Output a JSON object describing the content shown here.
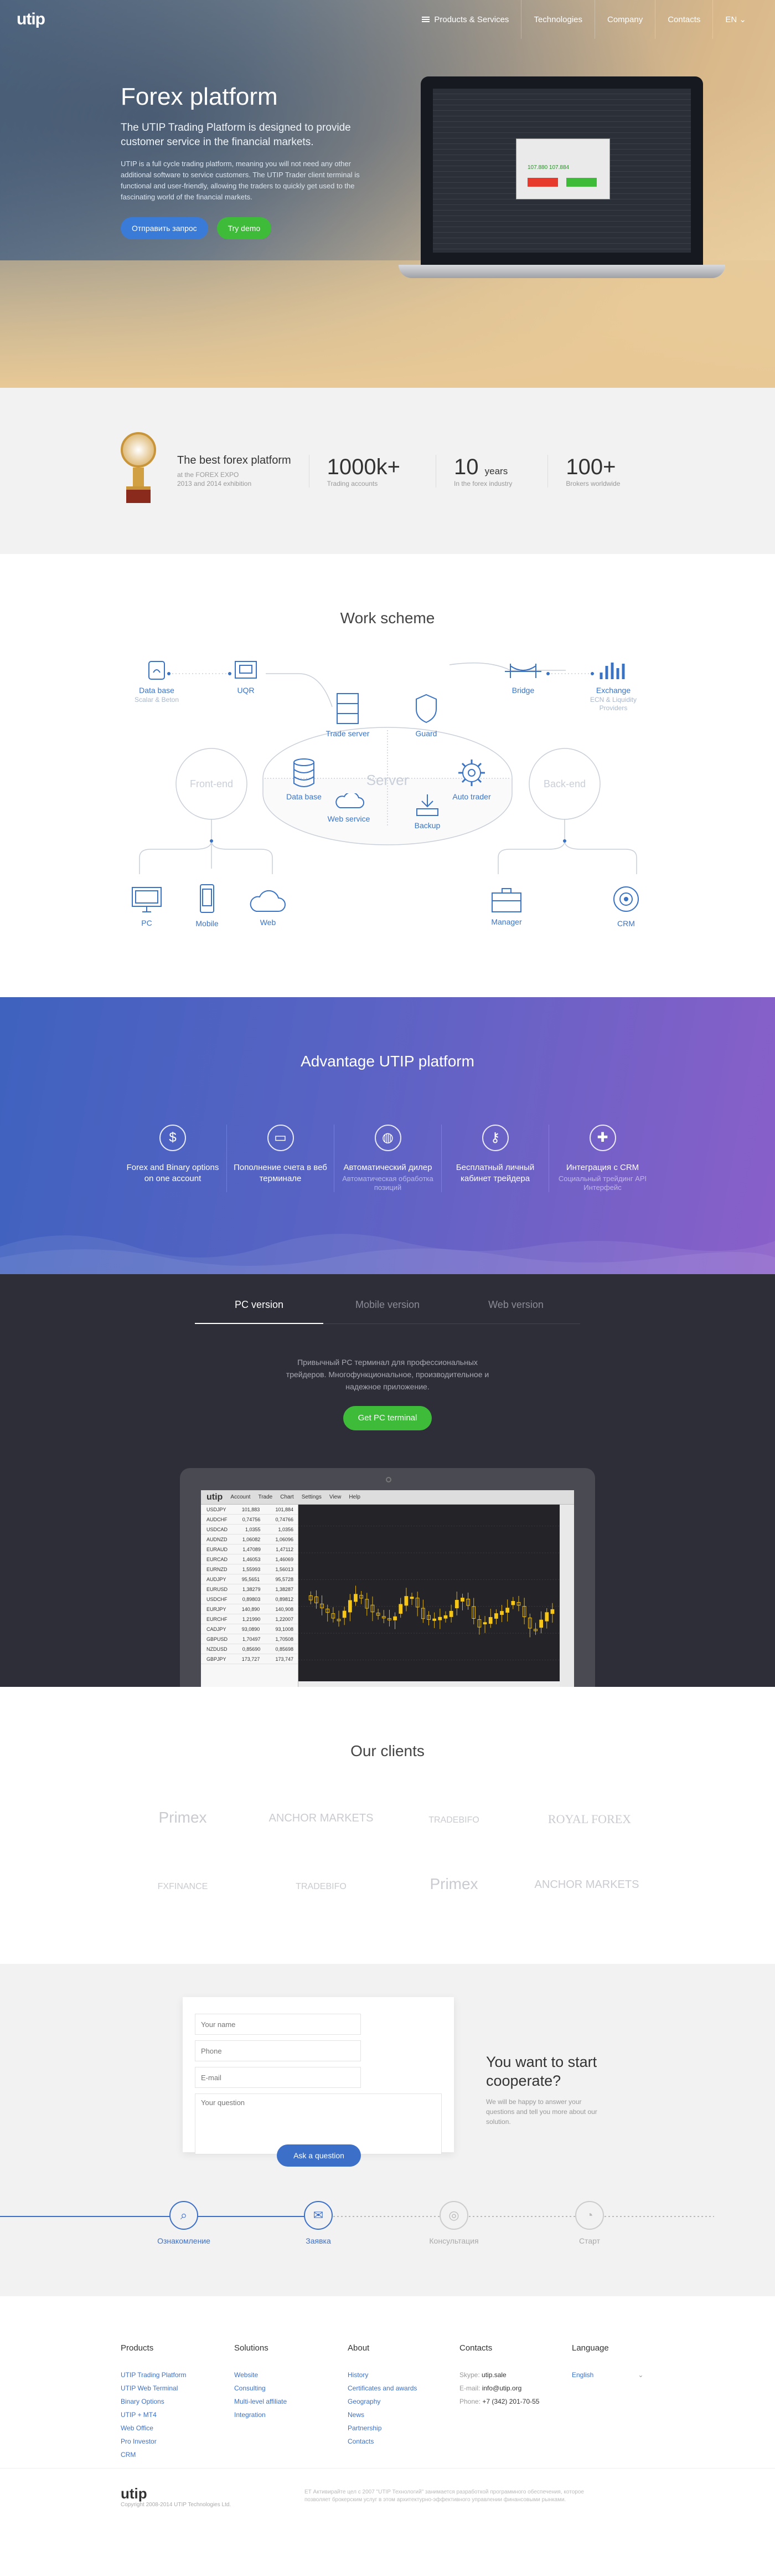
{
  "header": {
    "logo": "utip",
    "nav": [
      "Products & Services",
      "Technologies",
      "Company",
      "Contacts"
    ],
    "lang": "EN"
  },
  "hero": {
    "title": "Forex platform",
    "lead": "The UTIP Trading Platform is designed to provide customer service in the financial markets.",
    "desc": "UTIP is a full cycle trading platform, meaning you will not need any other additional software to service customers. The UTIP Trader client terminal is functional and user-friendly, allowing the traders to quickly get used to the fascinating world of the financial markets.",
    "btn_request": "Отправить запрос",
    "btn_demo": "Try demo",
    "screen_price": "107.880 107.884"
  },
  "stats": {
    "award_title": "The best forex platform",
    "award_sub1": "at the FOREX EXPO",
    "award_sub2": "2013 and 2014 exhibition",
    "items": [
      {
        "big": "1000k+",
        "small": "",
        "label": "Trading accounts"
      },
      {
        "big": "10",
        "small": "years",
        "label": "In the forex industry"
      },
      {
        "big": "100+",
        "small": "",
        "label": "Brokers worldwide"
      }
    ]
  },
  "scheme": {
    "title": "Work scheme",
    "nodes": {
      "database_left": "Data base",
      "database_left_sub": "Scalar & Beton",
      "uqr": "UQR",
      "bridge": "Bridge",
      "exchange": "Exchange",
      "exchange_sub": "ECN & Liquidity Providers",
      "trade_server": "Trade server",
      "guard": "Guard",
      "server": "Server",
      "front_end": "Front-end",
      "back_end": "Back-end",
      "data_base": "Data base",
      "auto_trader": "Auto trader",
      "web_service": "Web service",
      "backup": "Backup",
      "pc": "PC",
      "mobile": "Mobile",
      "web": "Web",
      "manager": "Manager",
      "crm": "CRM"
    }
  },
  "advantage": {
    "title": "Advantage UTIP platform",
    "items": [
      {
        "label": "Forex and Binary options on one account",
        "sub": "",
        "icon": "dollar-icon"
      },
      {
        "label": "Пополнение счета в веб терминале",
        "sub": "",
        "icon": "card-icon"
      },
      {
        "label": "Автоматический дилер",
        "sub": "Автоматическая обработка позиций",
        "icon": "globe-icon"
      },
      {
        "label": "Бесплатный личный кабинет трейдера",
        "sub": "",
        "icon": "key-icon"
      },
      {
        "label": "Интеграция с CRM",
        "sub": "Социальный трейдинг API Интерфейс",
        "icon": "puzzle-icon"
      }
    ]
  },
  "versions": {
    "tabs": [
      "PC version",
      "Mobile version",
      "Web version"
    ],
    "desc": "Привычный PC терминал для профессиональных трейдеров. Многофункциональное, производительное и надежное приложение.",
    "button": "Get PC terminal",
    "terminal": {
      "logo": "utip",
      "menu": [
        "Account",
        "Trade",
        "Chart",
        "Settings",
        "View",
        "Help"
      ],
      "symbols": [
        [
          "USDJPY",
          "101,883",
          "101,884"
        ],
        [
          "AUDCHF",
          "0,74756",
          "0,74766"
        ],
        [
          "USDCAD",
          "1,0355",
          "1,0356"
        ],
        [
          "AUDNZD",
          "1,06082",
          "1,06096"
        ],
        [
          "EURAUD",
          "1,47089",
          "1,47112"
        ],
        [
          "EURCAD",
          "1,46053",
          "1,46069"
        ],
        [
          "EURNZD",
          "1,55993",
          "1,56013"
        ],
        [
          "AUDJPY",
          "95,5651",
          "95,5728"
        ],
        [
          "EURUSD",
          "1,38279",
          "1,38287"
        ],
        [
          "USDCHF",
          "0,89803",
          "0,89812"
        ],
        [
          "EURJPY",
          "140,890",
          "140,908"
        ],
        [
          "EURCHF",
          "1,21990",
          "1,22007"
        ],
        [
          "CADJPY",
          "93,0890",
          "93,1008"
        ],
        [
          "GBPUSD",
          "1,70497",
          "1,70508"
        ],
        [
          "NZDUSD",
          "0,85690",
          "0,85698"
        ],
        [
          "GBPJPY",
          "173,727",
          "173,747"
        ]
      ]
    }
  },
  "clients": {
    "title": "Our clients",
    "logos": [
      "Primex",
      "ANCHOR MARKETS",
      "TRADEBIFO",
      "ROYAL FOREX",
      "FXFINANCE",
      "TRADEBIFO",
      "Primex",
      "ANCHOR MARKETS"
    ]
  },
  "contact": {
    "name_placeholder": "Your name",
    "phone_placeholder": "Phone",
    "email_placeholder": "E-mail",
    "question_placeholder": "Your question",
    "button": "Ask a question",
    "heading": "You want to start cooperate?",
    "text": "We will be happy to answer your questions and tell you more about our solution.",
    "steps": [
      "Ознакомление",
      "Заявка",
      "Консультация",
      "Старт"
    ]
  },
  "footer": {
    "products": {
      "title": "Products",
      "links": [
        "UTIP Trading Platform",
        "UTIP Web Terminal",
        "Binary Options",
        "UTIP + MT4",
        "Web Office",
        "Pro Investor",
        "CRM"
      ]
    },
    "solutions": {
      "title": "Solutions",
      "links": [
        "Website",
        "Consulting",
        "Multi-level affiliate",
        "Integration"
      ]
    },
    "about": {
      "title": "About",
      "links": [
        "History",
        "Certificates and awards",
        "Geography",
        "News",
        "Partnership",
        "Contacts"
      ]
    },
    "contacts": {
      "title": "Contacts",
      "skype_label": "Skype:",
      "skype": "utip.sale",
      "email_label": "E-mail:",
      "email": "info@utip.org",
      "phone_label": "Phone:",
      "phone": "+7 (342) 201-70-55"
    },
    "language": {
      "title": "Language",
      "value": "English"
    },
    "bottom_logo": "utip",
    "copyright": "Copyright 2008-2014 UTIP Technologies Ltd.",
    "legal": "ЕТ Активирайте цел с 2007 \"UTIP Технологий\" занимается разработкой программного обеспечения, которое позволяет брокерским услуг в этом архитектурно-эффективного управлении финансовыми рынками."
  }
}
